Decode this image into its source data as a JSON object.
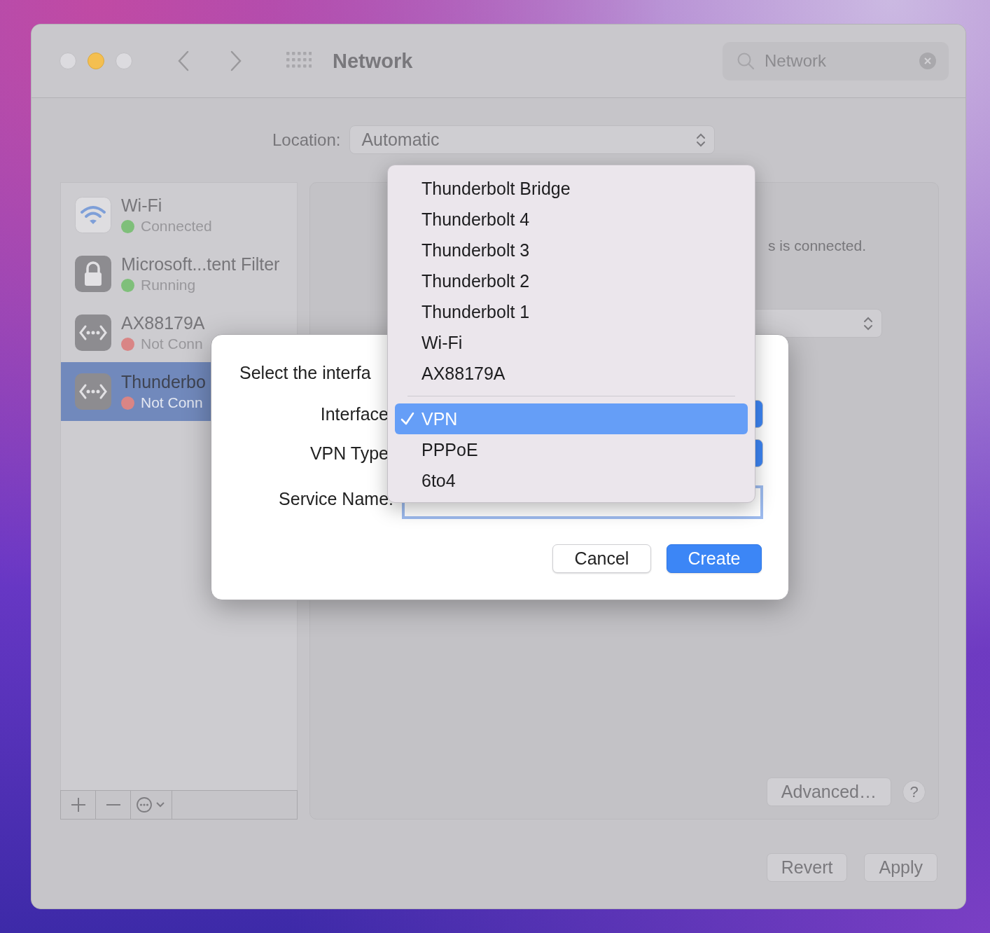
{
  "window": {
    "title": "Network"
  },
  "search": {
    "value": "Network"
  },
  "location": {
    "label": "Location:",
    "value": "Automatic"
  },
  "services": [
    {
      "name": "Wi-Fi",
      "status": "Connected",
      "color": "#7fbf7a",
      "kind": "wifi",
      "selected": false
    },
    {
      "name": "Microsoft...tent Filter",
      "status": "Running",
      "color": "#7fbf7a",
      "kind": "lock",
      "selected": false
    },
    {
      "name": "AX88179A",
      "status": "Not Conn",
      "color": "#d98585",
      "kind": "ethernet",
      "selected": false
    },
    {
      "name": "Thunderbo",
      "status": "Not Conn",
      "color": "#d98585",
      "kind": "ethernet",
      "selected": true
    }
  ],
  "panel": {
    "status_text": "s is connected.",
    "advanced_button": "Advanced…",
    "help_button": "?"
  },
  "footer_buttons": [
    "Revert",
    "Apply"
  ],
  "dialog": {
    "prompt": "Select the interfa",
    "fields": [
      {
        "label": "Interface",
        "kind": "popup"
      },
      {
        "label": "VPN Type",
        "kind": "popup"
      },
      {
        "label": "Service Name:",
        "kind": "text"
      }
    ],
    "buttons": [
      {
        "label": "Cancel",
        "kind": "secondary"
      },
      {
        "label": "Create",
        "kind": "primary"
      }
    ]
  },
  "menu": {
    "groups": [
      [
        {
          "label": "Thunderbolt Bridge",
          "selected": false
        },
        {
          "label": "Thunderbolt 4",
          "selected": false
        },
        {
          "label": "Thunderbolt 3",
          "selected": false
        },
        {
          "label": "Thunderbolt 2",
          "selected": false
        },
        {
          "label": "Thunderbolt 1",
          "selected": false
        },
        {
          "label": "Wi-Fi",
          "selected": false
        },
        {
          "label": "AX88179A",
          "selected": false
        }
      ],
      [
        {
          "label": "VPN",
          "selected": true
        },
        {
          "label": "PPPoE",
          "selected": false
        },
        {
          "label": "6to4",
          "selected": false
        }
      ]
    ]
  }
}
